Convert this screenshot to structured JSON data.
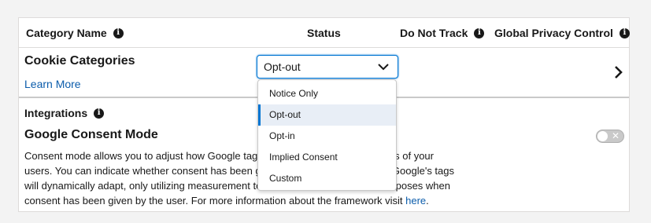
{
  "header": {
    "category_name": "Category Name",
    "status": "Status",
    "do_not_track": "Do Not Track",
    "global_privacy_control": "Global Privacy Control",
    "info_glyph": "i"
  },
  "cookie_categories": {
    "title": "Cookie Categories",
    "learn_more": "Learn More",
    "status_value": "Opt-out"
  },
  "integrations": {
    "title": "Integrations",
    "google_consent_mode": {
      "title": "Google Consent Mode",
      "description_lines": [
        "Consent mode allows you to adjust how Google tags be",
        "s of your",
        "users. You can indicate whether consent has been gran",
        ". Google's tags",
        "will dynamically adapt, only utilizing measurement too",
        "rposes when",
        "consent has been given by the user. For more information about the framework visit "
      ],
      "link_text": "here",
      "link_suffix": ".",
      "toggle_glyph": "✕",
      "toggle_on": false
    }
  },
  "dropdown": {
    "options": [
      "Notice Only",
      "Opt-out",
      "Opt-in",
      "Implied Consent",
      "Custom"
    ],
    "selected": "Opt-out"
  },
  "colors": {
    "accent": "#0176d3",
    "link": "#0b5cab",
    "selected_bg": "#e8eef6"
  }
}
